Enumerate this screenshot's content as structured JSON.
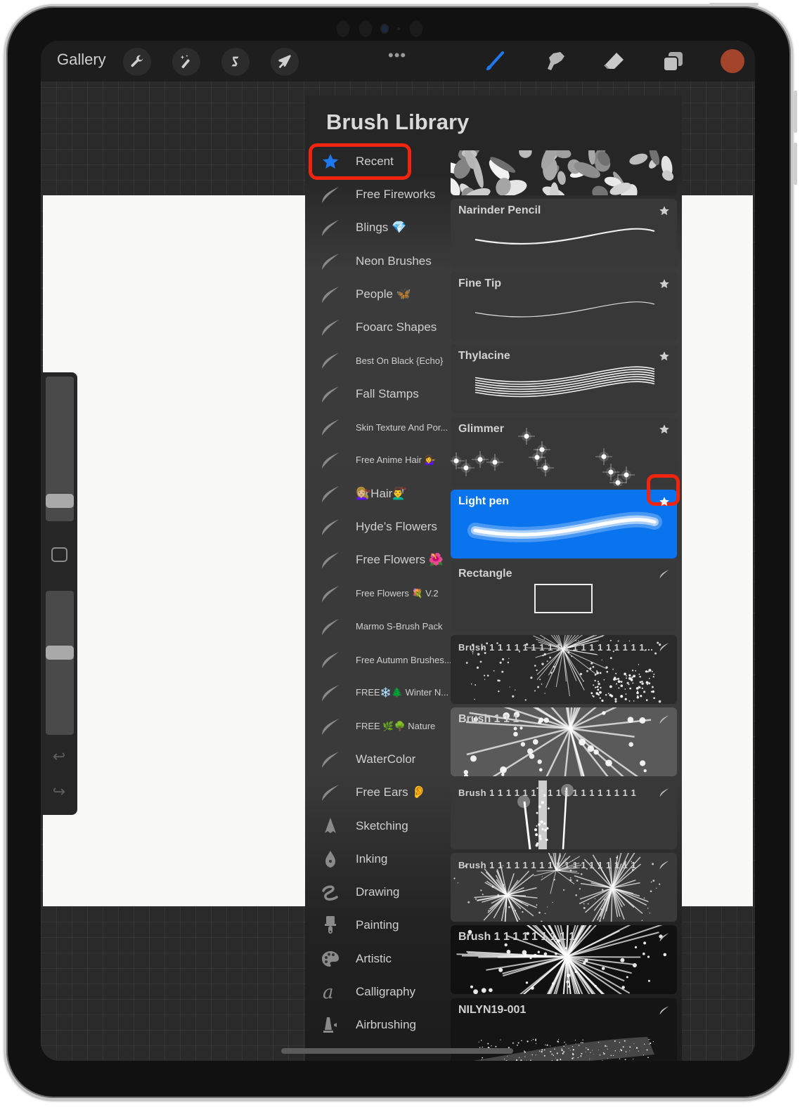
{
  "toolbar": {
    "gallery_label": "Gallery",
    "left_tools": [
      {
        "icon": "wrench-icon",
        "name": "actions"
      },
      {
        "icon": "magic-wand-icon",
        "name": "adjustments"
      },
      {
        "icon": "selection-icon",
        "name": "selection"
      },
      {
        "icon": "arrow-cursor-icon",
        "name": "transform"
      }
    ],
    "more_label": "•••",
    "right_tools": [
      {
        "icon": "brush-icon",
        "name": "paint",
        "active": true
      },
      {
        "icon": "smudge-icon",
        "name": "smudge"
      },
      {
        "icon": "eraser-icon",
        "name": "erase"
      },
      {
        "icon": "layers-icon",
        "name": "layers"
      }
    ],
    "current_color": "#a4442a",
    "active_color": "#1f78f0"
  },
  "side_toolbar": {
    "brush_size_level": 0.1,
    "opacity_level": 0.58,
    "undo_icon": "↩",
    "redo_icon": "↪"
  },
  "brush_library": {
    "title": "Brush Library",
    "brush_sets": [
      {
        "label": "Recent",
        "icon": "star-icon",
        "selected": true
      },
      {
        "label": "Free Fireworks",
        "icon": "stroke-icon"
      },
      {
        "label": "Blings 💎",
        "icon": "stroke-icon"
      },
      {
        "label": "Neon Brushes",
        "icon": "stroke-icon"
      },
      {
        "label": "People 🦋",
        "icon": "stroke-icon"
      },
      {
        "label": "Fooarc Shapes",
        "icon": "stroke-icon"
      },
      {
        "label": "Best On Black {Echo}",
        "icon": "stroke-icon",
        "small": true
      },
      {
        "label": "Fall Stamps",
        "icon": "stroke-icon"
      },
      {
        "label": "Skin Texture And Por...",
        "icon": "stroke-icon",
        "small": true
      },
      {
        "label": "Free Anime Hair 💁‍♀️",
        "icon": "stroke-icon",
        "small": true
      },
      {
        "label": "💇🏼‍♀️Hair💇‍♂️",
        "icon": "stroke-icon"
      },
      {
        "label": "Hyde’s Flowers",
        "icon": "stroke-icon"
      },
      {
        "label": "Free Flowers 🌺",
        "icon": "stroke-icon"
      },
      {
        "label": "Free Flowers 💐 V.2",
        "icon": "stroke-icon",
        "small": true
      },
      {
        "label": "Marmo S-Brush Pack",
        "icon": "stroke-icon",
        "small": true
      },
      {
        "label": "Free Autumn Brushes...",
        "icon": "stroke-icon",
        "small": true
      },
      {
        "label": "FREE❄️🌲 Winter N...",
        "icon": "stroke-icon",
        "small": true
      },
      {
        "label": "FREE 🌿🌳 Nature",
        "icon": "stroke-icon",
        "small": true
      },
      {
        "label": "WaterColor",
        "icon": "stroke-icon"
      },
      {
        "label": "Free Ears 👂",
        "icon": "stroke-icon"
      },
      {
        "label": "Sketching",
        "icon": "pencil-tip-icon"
      },
      {
        "label": "Inking",
        "icon": "pen-nib-icon"
      },
      {
        "label": "Drawing",
        "icon": "squiggle-icon"
      },
      {
        "label": "Painting",
        "icon": "paintbrush-icon"
      },
      {
        "label": "Artistic",
        "icon": "palette-icon"
      },
      {
        "label": "Calligraphy",
        "icon": "calligraphy-a-icon"
      },
      {
        "label": "Airbrushing",
        "icon": "airbrush-icon"
      }
    ],
    "brushes": [
      {
        "name": "",
        "preview": "leaves",
        "badge": "none"
      },
      {
        "name": "Narinder Pencil",
        "preview": "thin-line",
        "badge": "star"
      },
      {
        "name": "Fine Tip",
        "preview": "hair-line",
        "badge": "star"
      },
      {
        "name": "Thylacine",
        "preview": "multi-line",
        "badge": "star"
      },
      {
        "name": "Glimmer",
        "preview": "sparkles",
        "badge": "star"
      },
      {
        "name": "Light pen",
        "preview": "glow-line",
        "badge": "star",
        "selected": true
      },
      {
        "name": "Rectangle",
        "preview": "rectangle",
        "badge": "stroke"
      },
      {
        "name": "Brush  1 1 1 1 1 1 1 1 1 1 1 1 1 1 1 1 1 1 1...",
        "preview": "fireworks-1",
        "badge": "stroke",
        "small": true
      },
      {
        "name": "Brush  1 1 1",
        "preview": "fireworks-2",
        "badge": "stroke"
      },
      {
        "name": "Brush  1 1 1 1 1 1 1 1 1 1 1 1 1 1 1 1 1 1",
        "preview": "fireworks-3",
        "badge": "stroke",
        "small": true
      },
      {
        "name": "Brush  1 1 1 1 1 1 1 1 1 1 1 1 1 1 1 1 1 1",
        "preview": "fireworks-4",
        "badge": "stroke",
        "small": true
      },
      {
        "name": "Brush  1 1 1 1 1 1 1 1 1",
        "preview": "fireworks-5",
        "badge": "stroke"
      },
      {
        "name": "NILYN19-001",
        "preview": "spray",
        "badge": "stroke"
      }
    ],
    "selected_color": "#0a74ef",
    "annotation_color": "#f0240f"
  }
}
